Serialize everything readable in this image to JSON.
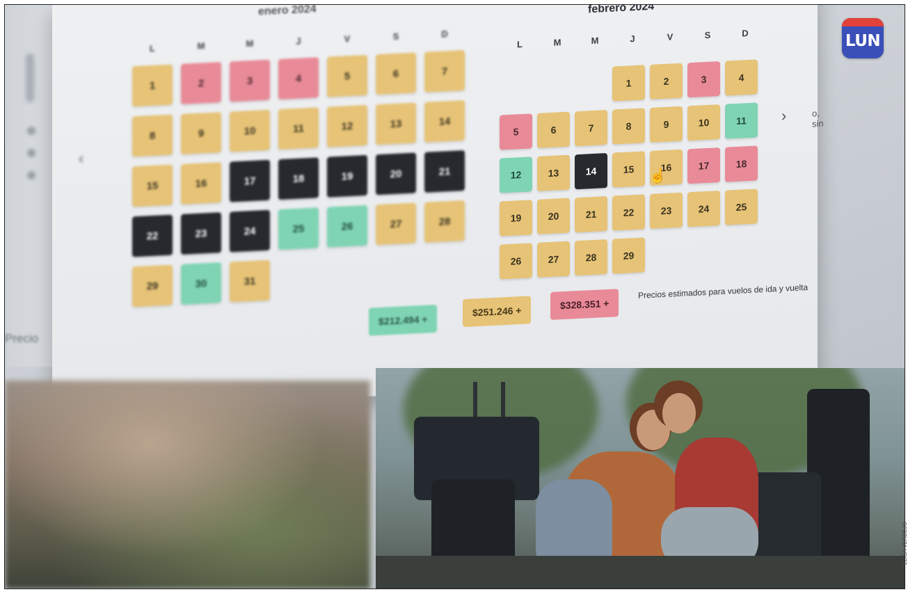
{
  "brand": {
    "logo_text": "LUN",
    "colors": {
      "blue": "#3b4fb8",
      "red": "#e2423a"
    }
  },
  "credit": "ELISA VERDEJO",
  "calendar": {
    "colors": {
      "yellow": "#e6c377",
      "pink": "#e98a98",
      "green": "#7fd4b3",
      "dark": "#262a2e"
    },
    "january": {
      "title": "enero 2024",
      "weekdays": [
        "L",
        "M",
        "M",
        "J",
        "V",
        "S",
        "D"
      ],
      "days": [
        {
          "n": "1",
          "c": "yellow"
        },
        {
          "n": "2",
          "c": "pink"
        },
        {
          "n": "3",
          "c": "pink"
        },
        {
          "n": "4",
          "c": "pink"
        },
        {
          "n": "5",
          "c": "yellow"
        },
        {
          "n": "6",
          "c": "yellow"
        },
        {
          "n": "7",
          "c": "yellow"
        },
        {
          "n": "8",
          "c": "yellow"
        },
        {
          "n": "9",
          "c": "yellow"
        },
        {
          "n": "10",
          "c": "yellow"
        },
        {
          "n": "11",
          "c": "yellow"
        },
        {
          "n": "12",
          "c": "yellow"
        },
        {
          "n": "13",
          "c": "yellow"
        },
        {
          "n": "14",
          "c": "yellow"
        },
        {
          "n": "15",
          "c": "yellow"
        },
        {
          "n": "16",
          "c": "yellow"
        },
        {
          "n": "17",
          "c": "dark"
        },
        {
          "n": "18",
          "c": "dark"
        },
        {
          "n": "19",
          "c": "dark"
        },
        {
          "n": "20",
          "c": "dark"
        },
        {
          "n": "21",
          "c": "dark"
        },
        {
          "n": "22",
          "c": "dark"
        },
        {
          "n": "23",
          "c": "dark"
        },
        {
          "n": "24",
          "c": "dark"
        },
        {
          "n": "25",
          "c": "green"
        },
        {
          "n": "26",
          "c": "green"
        },
        {
          "n": "27",
          "c": "yellow"
        },
        {
          "n": "28",
          "c": "yellow"
        },
        {
          "n": "29",
          "c": "yellow"
        },
        {
          "n": "30",
          "c": "green"
        },
        {
          "n": "31",
          "c": "yellow"
        }
      ]
    },
    "february": {
      "title": "febrero 2024",
      "weekdays": [
        "L",
        "M",
        "M",
        "J",
        "V",
        "S",
        "D"
      ],
      "days": [
        {
          "n": "1",
          "c": "yellow"
        },
        {
          "n": "2",
          "c": "yellow"
        },
        {
          "n": "3",
          "c": "pink"
        },
        {
          "n": "4",
          "c": "yellow"
        },
        {
          "n": "5",
          "c": "pink"
        },
        {
          "n": "6",
          "c": "yellow"
        },
        {
          "n": "7",
          "c": "yellow"
        },
        {
          "n": "8",
          "c": "yellow"
        },
        {
          "n": "9",
          "c": "yellow"
        },
        {
          "n": "10",
          "c": "yellow"
        },
        {
          "n": "11",
          "c": "green"
        },
        {
          "n": "12",
          "c": "green"
        },
        {
          "n": "13",
          "c": "yellow"
        },
        {
          "n": "14",
          "c": "dark"
        },
        {
          "n": "15",
          "c": "yellow"
        },
        {
          "n": "16",
          "c": "yellow"
        },
        {
          "n": "17",
          "c": "pink"
        },
        {
          "n": "18",
          "c": "pink"
        },
        {
          "n": "19",
          "c": "yellow"
        },
        {
          "n": "20",
          "c": "yellow"
        },
        {
          "n": "21",
          "c": "yellow"
        },
        {
          "n": "22",
          "c": "yellow"
        },
        {
          "n": "23",
          "c": "yellow"
        },
        {
          "n": "24",
          "c": "yellow"
        },
        {
          "n": "25",
          "c": "yellow"
        },
        {
          "n": "26",
          "c": "yellow"
        },
        {
          "n": "27",
          "c": "yellow"
        },
        {
          "n": "28",
          "c": "yellow"
        },
        {
          "n": "29",
          "c": "yellow"
        }
      ]
    },
    "legend": [
      {
        "label": "$212.494 +",
        "c": "green"
      },
      {
        "label": "$251.246 +",
        "c": "yellow"
      },
      {
        "label": "$328.351 +",
        "c": "pink"
      }
    ],
    "legend_note": "Precios estimados para vuelos de ida y vuelta",
    "nav": {
      "prev_icon": "chevron-left-icon",
      "next_icon": "chevron-right-icon",
      "next_glyph": "›",
      "prev_glyph": "‹"
    },
    "side_snippet": "o, sin",
    "cursor_glyph": "☝"
  },
  "sidebar": {
    "blurred_word": "Precio"
  }
}
